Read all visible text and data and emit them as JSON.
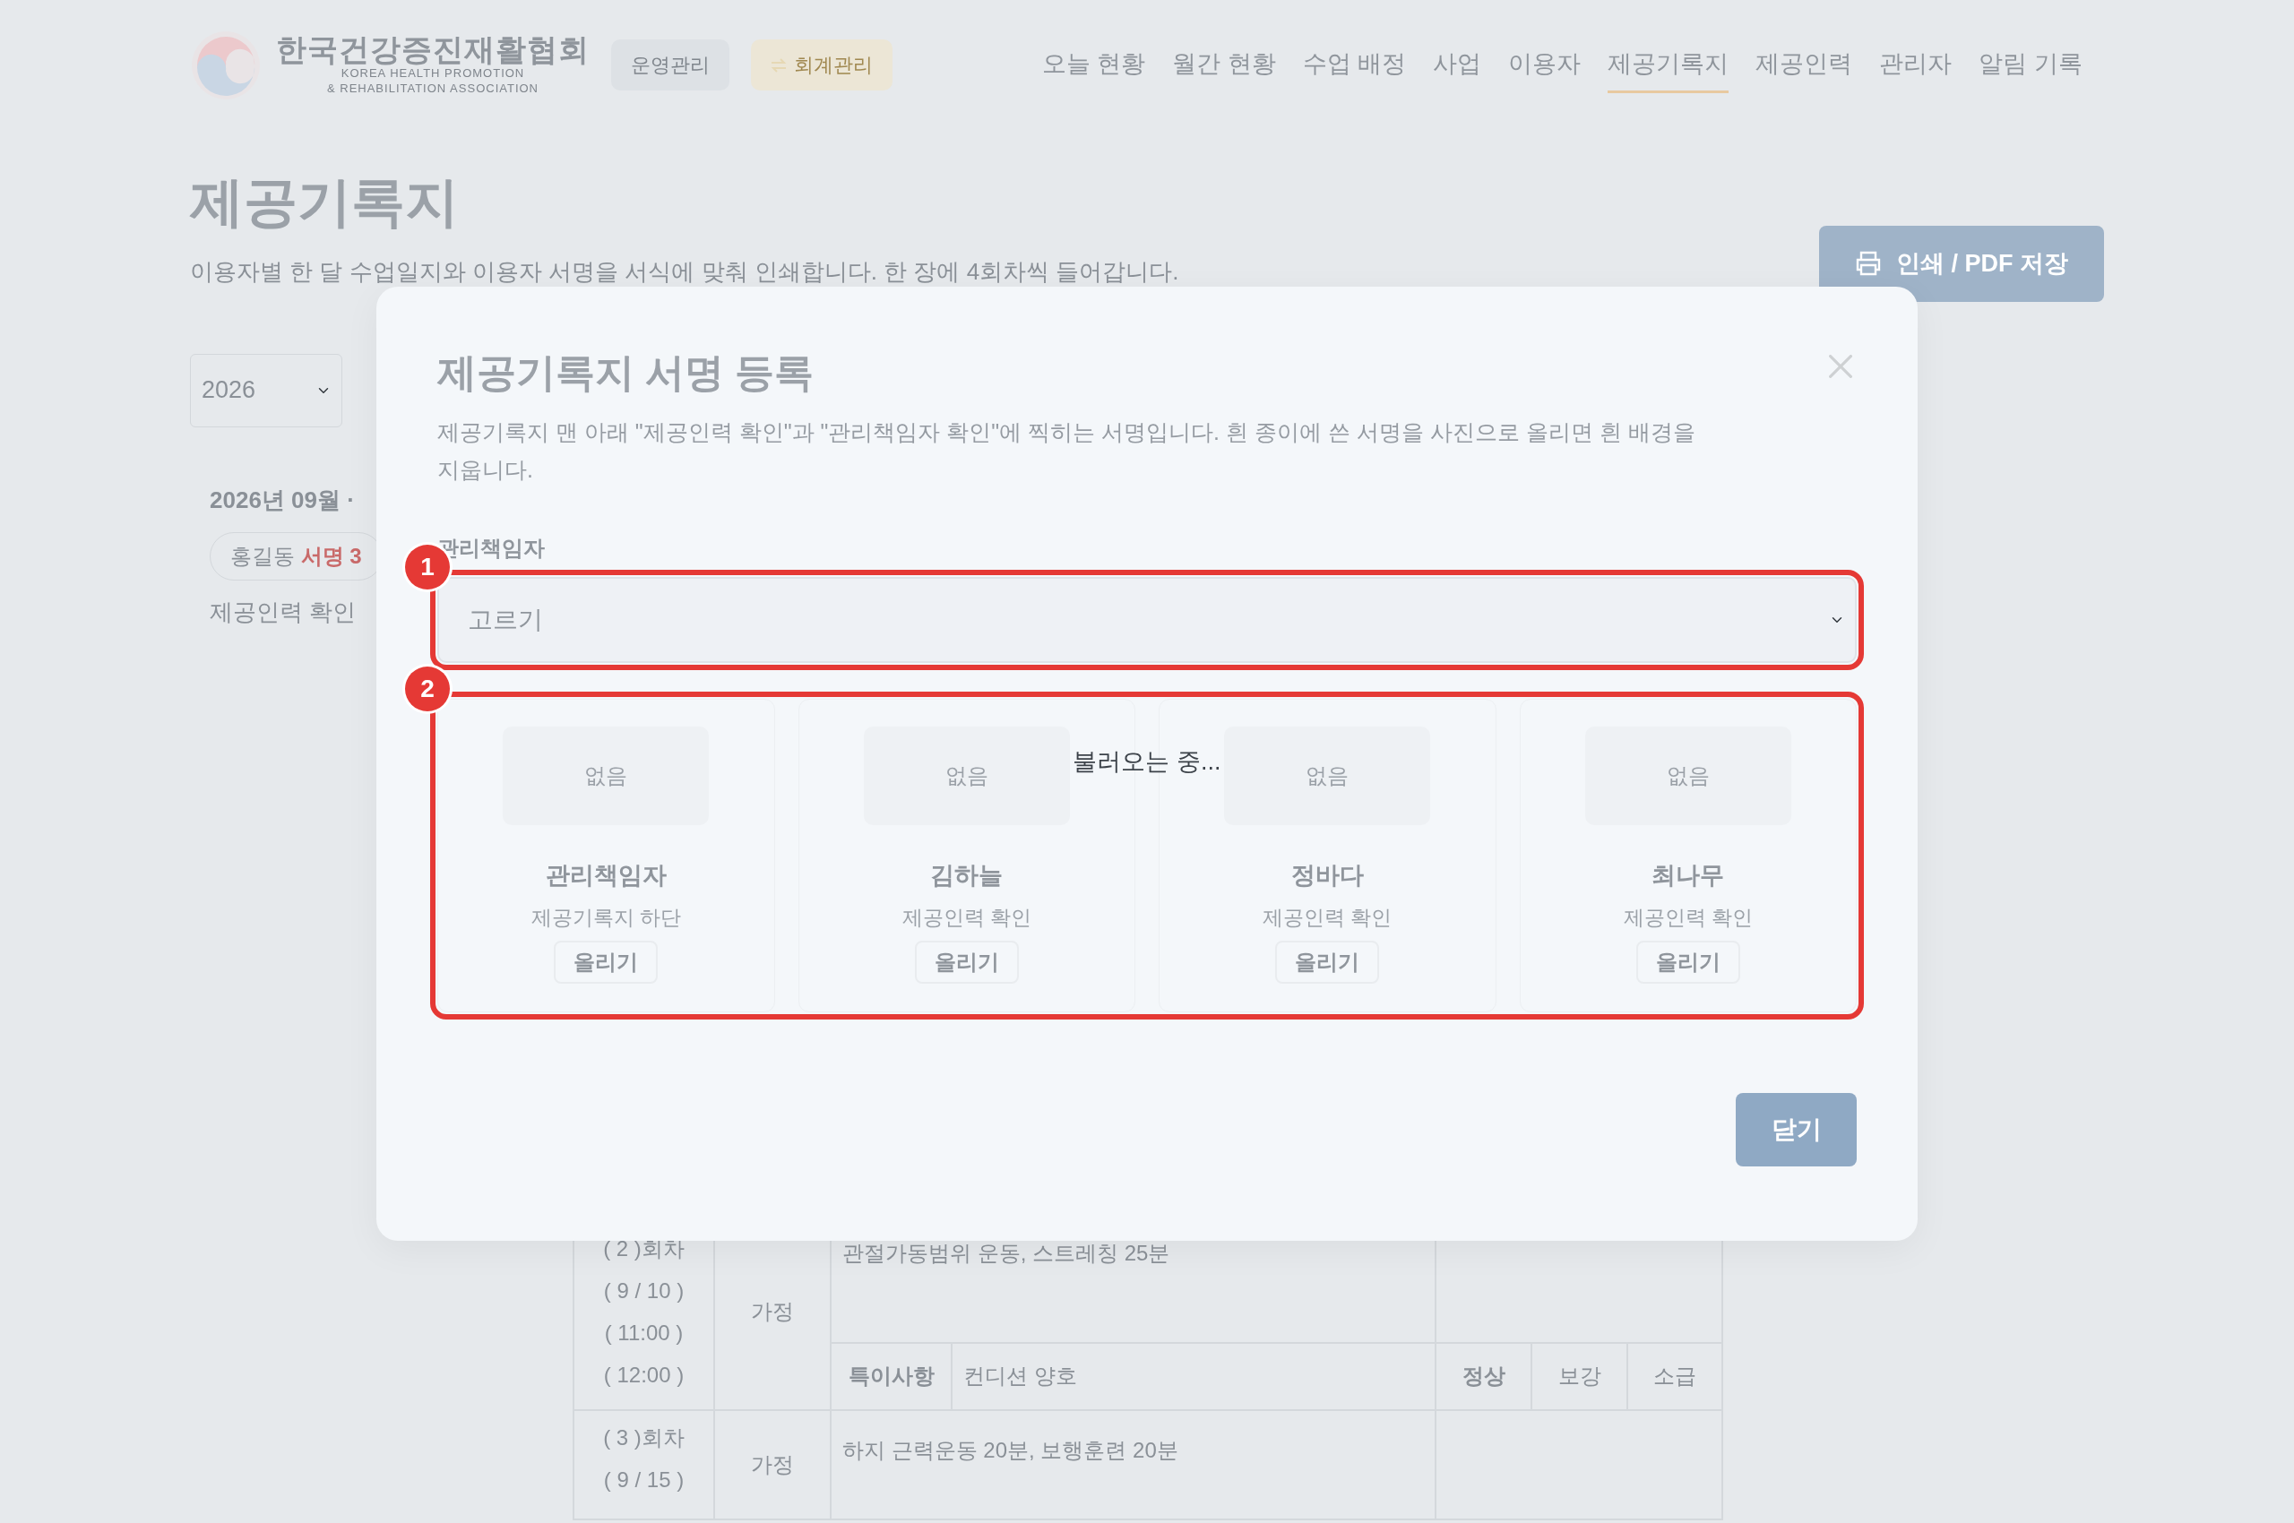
{
  "header": {
    "logo_title": "한국건강증진재활협회",
    "logo_subtitle": [
      "KOREA HEALTH PROMOTION",
      "& REHABILITATION ASSOCIATION"
    ],
    "mode_buttons": [
      {
        "label": "운영관리",
        "kind": "plain"
      },
      {
        "label": "회계관리",
        "kind": "switch"
      }
    ],
    "nav": [
      {
        "label": "오늘 현황",
        "selected": false
      },
      {
        "label": "월간 현황",
        "selected": false
      },
      {
        "label": "수업 배정",
        "selected": false
      },
      {
        "label": "사업",
        "selected": false
      },
      {
        "label": "이용자",
        "selected": false
      },
      {
        "label": "제공기록지",
        "selected": true
      },
      {
        "label": "제공인력",
        "selected": false
      },
      {
        "label": "관리자",
        "selected": false
      },
      {
        "label": "알림 기록",
        "selected": false
      }
    ]
  },
  "page": {
    "title": "제공기록지",
    "subtitle": "이용자별 한 달 수업일지와 이용자 서명을 서식에 맞춰 인쇄합니다. 한 장에 4회차씩 들어갑니다.",
    "print_button": "인쇄 / PDF 저장",
    "year_select": "2026",
    "summary": {
      "heading": "2026년 09월 ·",
      "chip_name": "홍길동",
      "chip_badge": "서명 3",
      "note": "제공인력 확인"
    }
  },
  "table": {
    "rows": [
      {
        "session": [
          "( 2 )회차",
          "( 9 / 10 )",
          "( 11:00 )",
          "( 12:00 )"
        ],
        "place": "가정",
        "content": "관절가동범위 운동, 스트레칭 25분",
        "note_label": "특이사항",
        "note": "컨디션 양호",
        "statuses": [
          {
            "label": "정상",
            "selected": true
          },
          {
            "label": "보강",
            "selected": false
          },
          {
            "label": "소급",
            "selected": false
          }
        ]
      },
      {
        "session": [
          "( 3 )회차",
          "( 9 / 15 )"
        ],
        "place": "가정",
        "content": "하지 근력운동 20분, 보행훈련 20분"
      }
    ]
  },
  "modal": {
    "title": "제공기록지 서명 등록",
    "description": "제공기록지 맨 아래 \"제공인력 확인\"과 \"관리책임자 확인\"에 찍히는 서명입니다. 흰 종이에 쓴 서명을 사진으로 올리면 흰 배경을 지웁니다.",
    "field_label": "관리책임자",
    "select": {
      "placeholder": "고르기"
    },
    "signers": [
      {
        "preview": "없음",
        "name": "관리책임자",
        "role": "제공기록지 하단",
        "button": "올리기"
      },
      {
        "preview": "없음",
        "name": "김하늘",
        "role": "제공인력 확인",
        "button": "올리기"
      },
      {
        "preview": "없음",
        "name": "정바다",
        "role": "제공인력 확인",
        "button": "올리기"
      },
      {
        "preview": "없음",
        "name": "최나무",
        "role": "제공인력 확인",
        "button": "올리기"
      }
    ],
    "loading": "불러오는 중...",
    "close_button": "닫기"
  },
  "annotations": [
    {
      "label": "1"
    },
    {
      "label": "2"
    }
  ]
}
